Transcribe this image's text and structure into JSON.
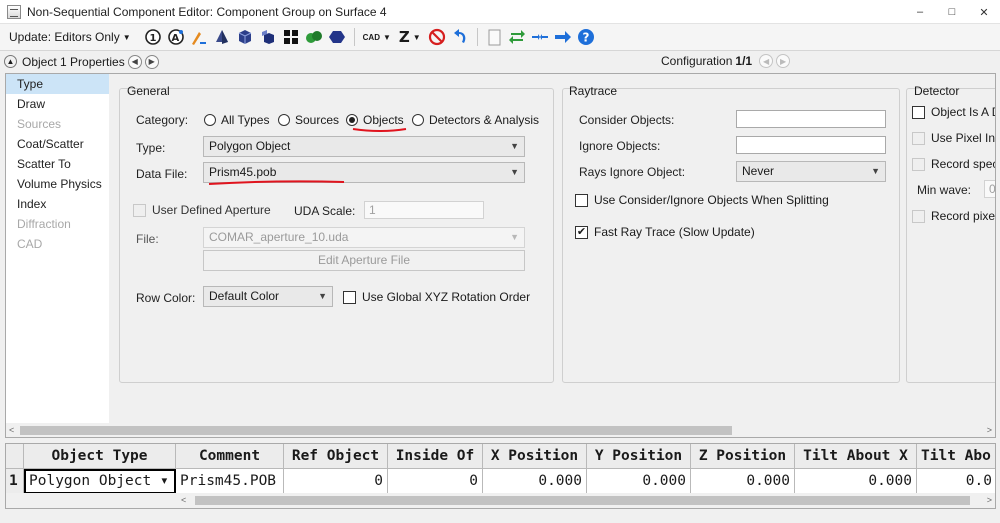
{
  "window": {
    "title": "Non-Sequential Component Editor: Component Group on Surface 4",
    "min": "–",
    "max": "□",
    "close": "✕"
  },
  "toolbar": {
    "update_label": "Update: Editors Only",
    "cad_label": "CAD",
    "z_label": "Z",
    "icons": [
      "glass-catalog-icon",
      "aperture-icon",
      "draw-icon",
      "solid-object-icon",
      "cube-icon",
      "cube-small-icon",
      "grid-icon",
      "merge-icon",
      "hexagon-icon",
      "cad-dropdown-icon",
      "z-dropdown-icon",
      "no-icon",
      "undo-icon",
      "page-icon",
      "swap-icon",
      "arrows-in-icon",
      "arrow-right-icon",
      "help-icon"
    ]
  },
  "props_header": {
    "title": "Object 1 Properties",
    "config_label": "Configuration",
    "config_value": "1/1"
  },
  "side_nav": [
    {
      "label": "Type",
      "state": "selected"
    },
    {
      "label": "Draw",
      "state": "normal"
    },
    {
      "label": "Sources",
      "state": "disabled"
    },
    {
      "label": "Coat/Scatter",
      "state": "normal"
    },
    {
      "label": "Scatter To",
      "state": "normal"
    },
    {
      "label": "Volume Physics",
      "state": "normal"
    },
    {
      "label": "Index",
      "state": "normal"
    },
    {
      "label": "Diffraction",
      "state": "disabled"
    },
    {
      "label": "CAD",
      "state": "disabled"
    }
  ],
  "general": {
    "title": "General",
    "category_label": "Category:",
    "category_options": [
      {
        "label": "All Types",
        "selected": false
      },
      {
        "label": "Sources",
        "selected": false
      },
      {
        "label": "Objects",
        "selected": true
      },
      {
        "label": "Detectors & Analysis",
        "selected": false
      }
    ],
    "type_label": "Type:",
    "type_value": "Polygon Object",
    "data_file_label": "Data File:",
    "data_file_value": "Prism45.pob",
    "uda_label": "User Defined Aperture",
    "uda_scale_label": "UDA Scale:",
    "uda_scale_value": "1",
    "file_label": "File:",
    "file_value": "COMAR_aperture_10.uda",
    "edit_aperture_label": "Edit Aperture File",
    "row_color_label": "Row Color:",
    "row_color_value": "Default Color",
    "global_rotation_label": "Use Global XYZ Rotation Order"
  },
  "raytrace": {
    "title": "Raytrace",
    "consider_label": "Consider Objects:",
    "consider_value": "",
    "ignore_label": "Ignore Objects:",
    "ignore_value": "",
    "rays_ignore_label": "Rays Ignore Object:",
    "rays_ignore_value": "Never",
    "use_consider_label": "Use Consider/Ignore Objects When Splitting",
    "fast_ray_label": "Fast Ray Trace (Slow Update)",
    "fast_ray_checked": "✔"
  },
  "detector": {
    "title": "Detector",
    "object_is_label": "Object Is A D",
    "use_pixel_label": "Use Pixel Int",
    "record_spec_label": "Record spec",
    "min_wave_label": "Min wave:",
    "min_wave_value": "0",
    "record_pixel_label": "Record pixe"
  },
  "grid": {
    "headers": [
      "Object Type",
      "Comment",
      "Ref Object",
      "Inside Of",
      "X Position",
      "Y Position",
      "Z Position",
      "Tilt About X",
      "Tilt Abo"
    ],
    "row_number": "1",
    "row": [
      "Polygon Object ▾",
      "Prism45.POB",
      "0",
      "0",
      "0.000",
      "0.000",
      "0.000",
      "0.000",
      "0.0"
    ]
  },
  "colors": {
    "accent": "#cce4f7",
    "annotation_red": "#e0141e",
    "help_blue": "#1e6fd9"
  }
}
